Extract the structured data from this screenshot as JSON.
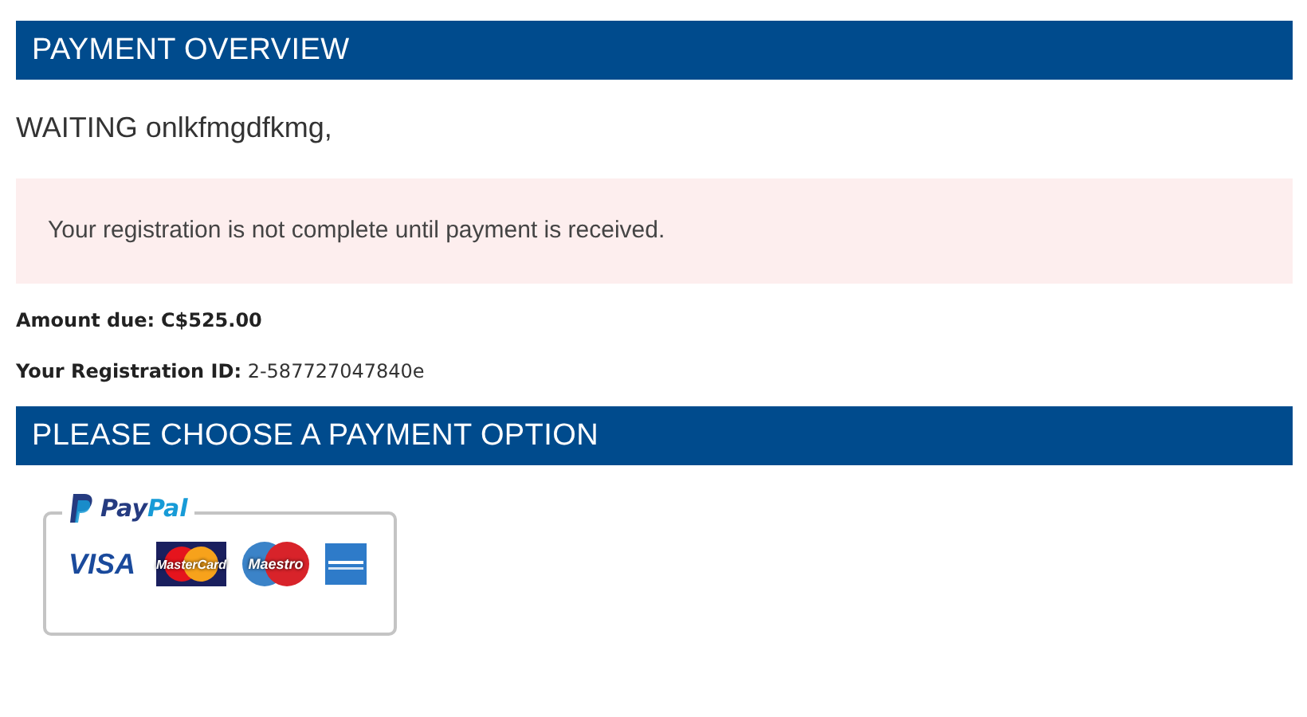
{
  "overview_header": "PAYMENT OVERVIEW",
  "status_line": "WAITING onlkfmgdfkmg,",
  "alert": "Your registration is not complete until payment is received.",
  "details": [
    {
      "label": "Amount due:",
      "value": "C$525.00",
      "value_bold": true
    },
    {
      "label": "Your Registration ID:",
      "value": "2-587727047840e",
      "value_bold": false
    }
  ],
  "options_header": "PLEASE CHOOSE A PAYMENT OPTION",
  "payment_button": {
    "brand": "PayPal",
    "cards": [
      {
        "kind": "visa",
        "label": "VISA"
      },
      {
        "kind": "mastercard",
        "label": "MasterCard"
      },
      {
        "kind": "maestro",
        "label": "Maestro"
      },
      {
        "kind": "amex"
      }
    ]
  }
}
